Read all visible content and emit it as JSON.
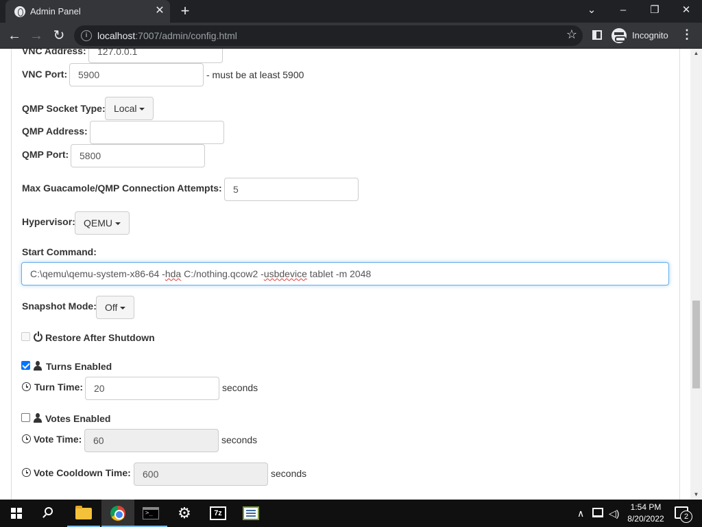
{
  "browser": {
    "tab_title": "Admin Panel",
    "url_host": "localhost",
    "url_rest": ":7007/admin/config.html",
    "profile_label": "Incognito"
  },
  "form": {
    "vnc_address": {
      "label": "VNC Address:",
      "value": "127.0.0.1"
    },
    "vnc_port": {
      "label": "VNC Port:",
      "value": "5900",
      "hint": "- must be at least 5900"
    },
    "qmp_socket_type": {
      "label": "QMP Socket Type:",
      "value": "Local"
    },
    "qmp_address": {
      "label": "QMP Address:",
      "value": ""
    },
    "qmp_port": {
      "label": "QMP Port:",
      "value": "5800"
    },
    "max_attempts": {
      "label": "Max Guacamole/QMP Connection Attempts:",
      "value": "5"
    },
    "hypervisor": {
      "label": "Hypervisor:",
      "value": "QEMU"
    },
    "start_command": {
      "label": "Start Command:",
      "part1": "C:\\qemu\\qemu-system-x86-64 -",
      "part2": "hda",
      "part3": " C:/nothing.qcow2 -",
      "part4": "usbdevice",
      "part5": " tablet -m 2048"
    },
    "snapshot_mode": {
      "label": "Snapshot Mode:",
      "value": "Off"
    },
    "restore_after_shutdown": {
      "label": "Restore After Shutdown",
      "checked": false,
      "disabled": true
    },
    "turns_enabled": {
      "label": "Turns Enabled",
      "checked": true
    },
    "turn_time": {
      "label": "Turn Time:",
      "value": "20",
      "unit": "seconds"
    },
    "votes_enabled": {
      "label": "Votes Enabled",
      "checked": false
    },
    "vote_time": {
      "label": "Vote Time:",
      "value": "60",
      "unit": "seconds"
    },
    "vote_cooldown": {
      "label": "Vote Cooldown Time:",
      "value": "600",
      "unit": "seconds"
    }
  },
  "taskbar": {
    "time": "1:54 PM",
    "date": "8/20/2022",
    "notification_count": "2"
  }
}
